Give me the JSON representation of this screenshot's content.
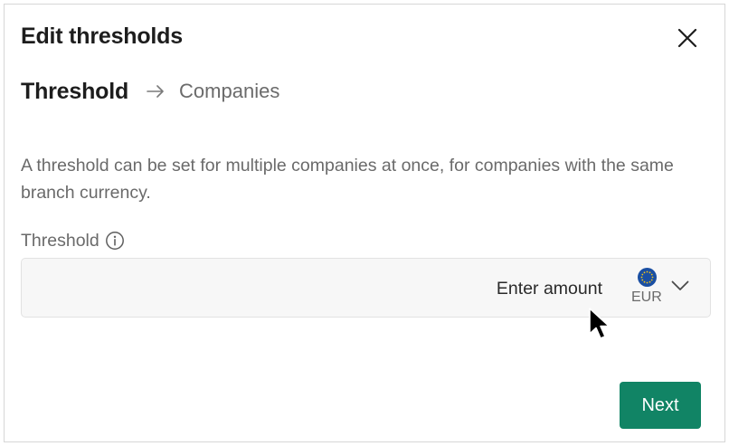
{
  "dialog": {
    "title": "Edit thresholds",
    "close_icon": "close-icon"
  },
  "stepper": {
    "steps": [
      {
        "label": "Threshold",
        "active": true
      },
      {
        "label": "Companies",
        "active": false
      }
    ],
    "separator_icon": "arrow-right-icon"
  },
  "description": "A threshold can be set for multiple companies at once, for companies with the same branch currency.",
  "threshold_field": {
    "label": "Threshold",
    "info_icon": "info-icon",
    "value": "",
    "placeholder": "Enter amount",
    "currency": {
      "code": "EUR",
      "flag_icon": "eu-flag-icon",
      "dropdown_icon": "chevron-down-icon"
    }
  },
  "footer": {
    "next_label": "Next"
  },
  "colors": {
    "primary_button": "#118465",
    "muted_text": "#6a6a6a",
    "field_background": "#f7f7f7",
    "eu_flag_blue": "#1a4fa3"
  }
}
